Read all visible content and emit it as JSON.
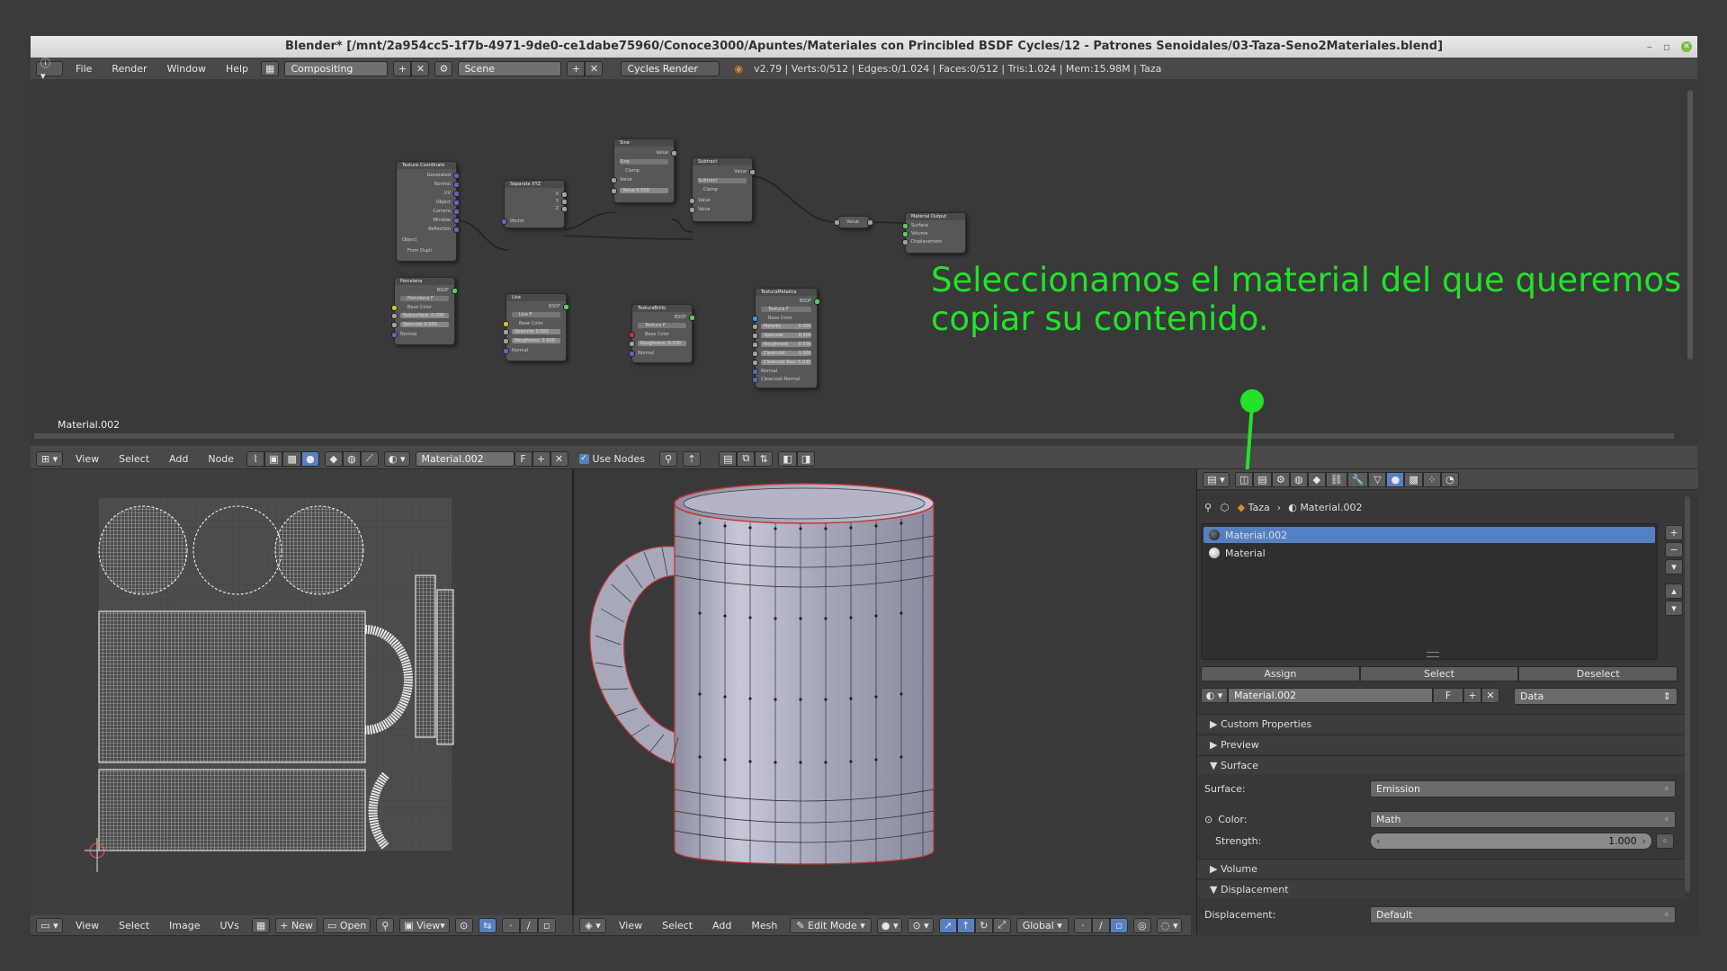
{
  "window": {
    "title": "Blender* [/mnt/2a954cc5-1f7b-4971-9de0-ce1dabe75960/Conoce3000/Apuntes/Materiales con Princibled BSDF Cycles/12 - Patrones Senoidales/03-Taza-Seno2Materiales.blend]",
    "controls": [
      "–",
      "▫",
      "✕"
    ]
  },
  "info_header": {
    "menus": [
      "File",
      "Render",
      "Window",
      "Help"
    ],
    "screen_layout": "Compositing",
    "scene": "Scene",
    "render_engine": "Cycles Render",
    "stats": "v2.79 | Verts:0/512 | Edges:0/1.024 | Faces:0/512 | Tris:1.024 | Mem:15.98M | Taza"
  },
  "node_editor": {
    "material_label": "Material.002",
    "header": {
      "menus": [
        "View",
        "Select",
        "Add",
        "Node"
      ],
      "material": "Material.002",
      "fake_user": "F",
      "use_nodes_label": "Use Nodes"
    },
    "nodes": {
      "texcoord": {
        "title": "Texture Coordinate",
        "outputs": [
          "Generated",
          "Normal",
          "UV",
          "Object",
          "Camera",
          "Window",
          "Reflection"
        ],
        "object_label": "Object",
        "from_dupli": "From Dupli"
      },
      "separate": {
        "title": "Separate XYZ",
        "outputs": [
          "X",
          "Y",
          "Z"
        ],
        "input": "Vector"
      },
      "sine": {
        "title": "Sine",
        "output": "Value",
        "op": "Sine",
        "clamp": "Clamp",
        "in1": "Value",
        "in2": "Value",
        "val": "0.500"
      },
      "subtract": {
        "title": "Subtract",
        "output": "Value",
        "op": "Subtract",
        "clamp": "Clamp",
        "in1": "Value",
        "in2": "Value"
      },
      "reroute": {
        "title": "Value"
      },
      "output": {
        "title": "Material Output",
        "inputs": [
          "Surface",
          "Volume",
          "Displacement"
        ]
      },
      "porcelana": {
        "title": "Porcelana",
        "bsdf": "BSDF",
        "mat": "Porcelana",
        "f": "F",
        "base": "Base Color",
        "sub": "Subsurface: 0.000",
        "spec_label": "Specular",
        "spec_val": "0.500",
        "normal": "Normal"
      },
      "lisa": {
        "title": "Lisa",
        "bsdf": "BSDF",
        "mat": "Lisa",
        "f": "F",
        "base": "Base Color",
        "spec_label": "Specular",
        "spec_val": "0.500",
        "rough": "Roughness: 0.500",
        "normal": "Normal"
      },
      "textura_brillo": {
        "title": "TexturaBrillo",
        "bsdf": "BSDF",
        "mat": "Textura",
        "f": "F",
        "base": "Base Color",
        "rough": "Roughness: 0.500",
        "normal": "Normal"
      },
      "textura_metal": {
        "title": "TexturaMetalica",
        "bsdf": "BSDF",
        "mat": "Textura",
        "f": "F",
        "base": "Base Color",
        "metal": "Metallic",
        "spec": "Specular",
        "rough": "Roughness",
        "clear": "Clearcoat",
        "clear_rough": "Clearcoat Rou: 0.030",
        "normal": "Normal",
        "clear_normal": "Clearcoat Normal",
        "v1": "0.000",
        "v2": "0.500",
        "v3": "0.500",
        "v4": "1.000"
      }
    }
  },
  "annotation": {
    "line1": "Seleccionamos el material del que queremos",
    "line2": "copiar su contenido."
  },
  "uv_editor": {
    "menus": [
      "View",
      "Select",
      "Image",
      "UVs"
    ],
    "new_label": "New",
    "open_label": "Open",
    "view_label": "View"
  },
  "viewport": {
    "menus": [
      "View",
      "Select",
      "Add",
      "Mesh"
    ],
    "mode": "Edit Mode",
    "orientation": "Global"
  },
  "properties": {
    "breadcrumb_object": "Taza",
    "breadcrumb_material": "Material.002",
    "slots": [
      {
        "name": "Material.002",
        "selected": true
      },
      {
        "name": "Material",
        "selected": false
      }
    ],
    "assign": "Assign",
    "select": "Select",
    "deselect": "Deselect",
    "material_name": "Material.002",
    "fake_user": "F",
    "link": "Data",
    "panels": {
      "custom_properties": "Custom Properties",
      "preview": "Preview",
      "surface": "Surface",
      "volume": "Volume",
      "displacement": "Displacement"
    },
    "surface_label": "Surface:",
    "surface_value": "Emission",
    "color_label": "Color:",
    "color_value": "Math",
    "strength_label": "Strength:",
    "strength_value": "1.000",
    "displacement_label": "Displacement:",
    "displacement_value": "Default"
  },
  "colors": {
    "annotation": "#22e22a",
    "selection": "#5680c2",
    "edge_red": "#c83232"
  }
}
